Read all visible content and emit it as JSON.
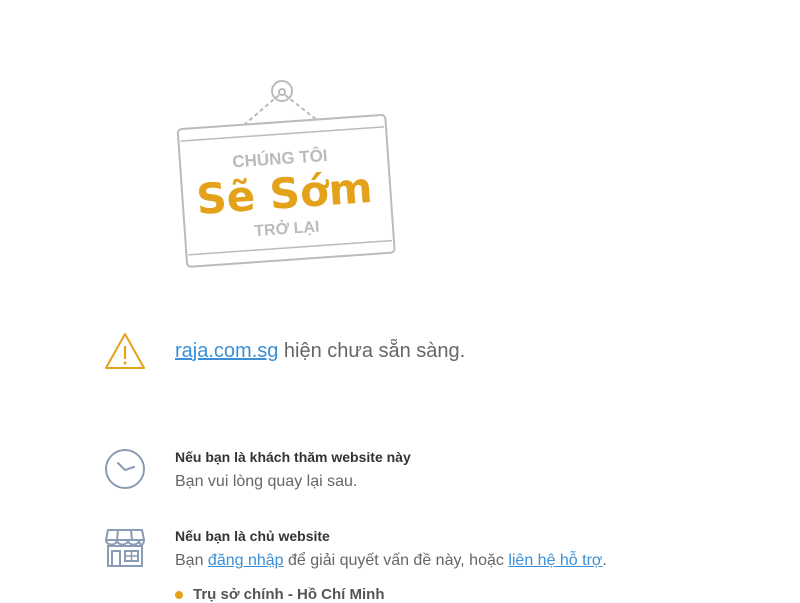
{
  "sign": {
    "line1": "CHÚNG TÔI",
    "line2": "Sẽ Sớm",
    "line3": "TRỞ LẠI"
  },
  "notice": {
    "domain": "raja.com.sg",
    "message": " hiện chưa sẵn sàng."
  },
  "visitor": {
    "title": "Nếu bạn là khách thăm website này",
    "body": "Bạn vui lòng quay lại sau."
  },
  "owner": {
    "title": "Nếu bạn là chủ website",
    "body_prefix": "Bạn ",
    "login_link": "đăng nhập",
    "body_middle": " để giải quyết vấn đề này, hoặc ",
    "support_link": "liên hệ hỗ trợ",
    "body_suffix": "."
  },
  "office": {
    "label": "Trụ sở chính - Hồ Chí Minh"
  },
  "colors": {
    "accent": "#e3a21a",
    "link": "#3a8fd6",
    "icon": "#8a9bb5"
  },
  "icons": [
    "warning-icon",
    "clock-icon",
    "store-icon"
  ]
}
